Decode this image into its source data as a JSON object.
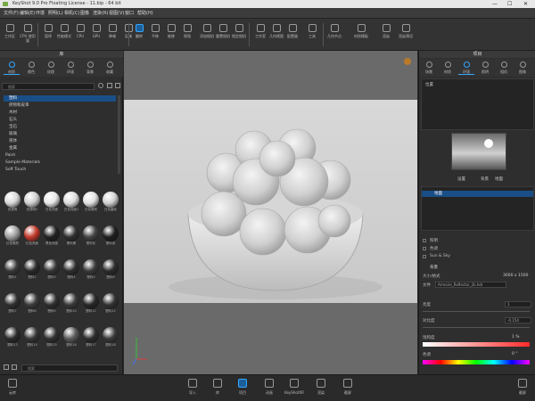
{
  "titlebar": {
    "title": "KeyShot 9.0 Pro Floating License - 11.bip - 64 bit",
    "minimize": "—",
    "maximize": "☐",
    "close": "✕"
  },
  "menu": [
    "文件(F)",
    "编辑(E)",
    "环境",
    "照明(L)",
    "相机(C)",
    "图像",
    "渲染(R)",
    "视图(V)",
    "窗口",
    "帮助(H)"
  ],
  "toolbar": {
    "items": [
      "工作区",
      "CPU 使用量",
      "暂停",
      "性能模式",
      "CPU",
      "GPU",
      "降噪",
      "区域",
      "翻转",
      "平移",
      "推移",
      "视角",
      "添加相机",
      "重置相机",
      "锁定相机",
      "工作室",
      "几何视图",
      "配置器",
      "工具",
      "几何节点",
      "材质模板",
      "渲染",
      "渲染预设"
    ],
    "active": "翻转"
  },
  "left_panel": {
    "title": "库",
    "tabs": [
      "材质",
      "颜色",
      "纹理",
      "环境",
      "背景",
      "收藏"
    ],
    "active_tab": "材质",
    "search_placeholder": "搜索",
    "tree": [
      "塑料",
      "织物和皮革",
      "木材",
      "石头",
      "宝石",
      "玻璃",
      "液体",
      "金属",
      "Paint",
      "Sample Materials",
      "Soft Touch"
    ],
    "selected": "塑料",
    "grid_search_placeholder": "搜索"
  },
  "materials": [
    {
      "label": "亮透明",
      "color": "#d8d8d8"
    },
    {
      "label": "亮透明2",
      "color": "#cfcfcf"
    },
    {
      "label": "白色亮面",
      "color": "#e6e6e6"
    },
    {
      "label": "白色亮面2",
      "color": "#dcdcdc"
    },
    {
      "label": "白色硬质",
      "color": "#e2e2e2"
    },
    {
      "label": "白色磨砂",
      "color": "#d0d0d0"
    },
    {
      "label": "红色硬质",
      "color": "#9e9e9e"
    },
    {
      "label": "红色亮面",
      "color": "#c0392b"
    },
    {
      "label": "黑色亮面",
      "color": "#222222"
    },
    {
      "label": "塑料黑",
      "color": "#303030"
    },
    {
      "label": "塑料灰",
      "color": "#444444"
    },
    {
      "label": "塑料深",
      "color": "#1e1e1e"
    },
    {
      "label": "塑料1",
      "color": "#383838"
    },
    {
      "label": "塑料2",
      "color": "#2a2a2a"
    },
    {
      "label": "塑料3",
      "color": "#353535"
    },
    {
      "label": "塑料4",
      "color": "#2e2e2e"
    },
    {
      "label": "塑料5",
      "color": "#3a3a3a"
    },
    {
      "label": "塑料6",
      "color": "#2c2c2c"
    },
    {
      "label": "塑料7",
      "color": "#303030"
    },
    {
      "label": "塑料8",
      "color": "#3b3b3b"
    },
    {
      "label": "塑料9",
      "color": "#2f2f2f"
    },
    {
      "label": "塑料10",
      "color": "#3a3a3a"
    },
    {
      "label": "塑料11",
      "color": "#272727"
    },
    {
      "label": "塑料12",
      "color": "#333333"
    },
    {
      "label": "塑料13",
      "color": "#2b2b2b"
    },
    {
      "label": "塑料14",
      "color": "#363636"
    },
    {
      "label": "塑料15",
      "color": "#303030"
    },
    {
      "label": "塑料16",
      "color": "#5a5a5a"
    },
    {
      "label": "塑料17",
      "color": "#2d2d2d"
    },
    {
      "label": "塑料18",
      "color": "#393939"
    }
  ],
  "right_panel": {
    "title": "项目",
    "tabs": [
      "场景",
      "材质",
      "环境",
      "照明",
      "相机",
      "图像"
    ],
    "active_tab": "环境",
    "env_root": "位置",
    "preview_actions": [
      "设置",
      "背景",
      "地面"
    ],
    "env_item": "地面",
    "options": [
      "照明",
      "色调",
      "Sun & Sky"
    ],
    "section": "背景",
    "size_label": "大小/格式",
    "size_value": "3000 x 1500",
    "file_label": "文件",
    "file_value": "Armoire_Reflector_2k.hdr",
    "brightness_label": "亮度",
    "brightness_value": "1",
    "contrast_label": "对比度",
    "contrast_value": "-0.154",
    "hue_label": "饱和度",
    "hue_value": "1 %",
    "tint_label": "色调",
    "tint_value": "0 °"
  },
  "bottom": {
    "left_label": "云库",
    "items": [
      "导入",
      "库",
      "项目",
      "动画",
      "KeyShotXR",
      "渲染",
      "截屏"
    ],
    "active": "项目",
    "right_label": "截屏"
  }
}
